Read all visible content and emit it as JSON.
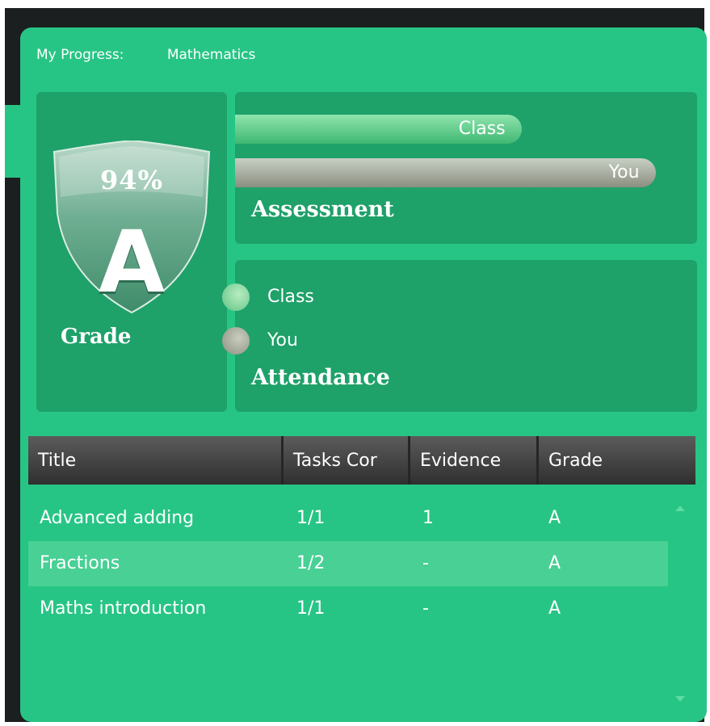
{
  "header": {
    "label": "My Progress:",
    "subject": "Mathematics"
  },
  "grade": {
    "percent": "94%",
    "letter": "A",
    "label": "Grade"
  },
  "assessment": {
    "title": "Assessment",
    "class_label": "Class",
    "you_label": "You",
    "class_fill": 0.62,
    "you_fill": 0.91
  },
  "attendance": {
    "title": "Attendance",
    "class_label": "Class",
    "you_label": "You"
  },
  "table": {
    "columns": [
      "Title",
      "Tasks Cor",
      "Evidence",
      "Grade"
    ],
    "rows": [
      {
        "title": "Advanced adding",
        "tasks": "1/1",
        "evidence": "1",
        "grade": "A",
        "selected": false
      },
      {
        "title": "Fractions",
        "tasks": "1/2",
        "evidence": "-",
        "grade": "A",
        "selected": true
      },
      {
        "title": "Maths introduction",
        "tasks": "1/1",
        "evidence": "-",
        "grade": "A",
        "selected": false
      }
    ]
  },
  "colors": {
    "panel": "#27c585",
    "box": "#1fa16a",
    "selected_row": "#48d095",
    "header_dark": "#2f2f2f"
  },
  "icons": {
    "scroll_up": "chevron-up-icon",
    "scroll_down": "chevron-down-icon",
    "badge": "shield-icon"
  }
}
